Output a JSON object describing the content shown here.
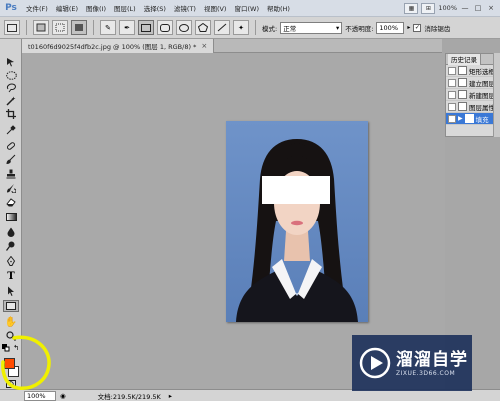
{
  "app": {
    "logo": "Ps"
  },
  "menu": [
    "文件(F)",
    "编辑(E)",
    "图像(I)",
    "图层(L)",
    "选择(S)",
    "滤镜(T)",
    "视图(V)",
    "窗口(W)",
    "帮助(H)"
  ],
  "menu_right": {
    "zoom": "100%",
    "minimize": "—",
    "restore": "□",
    "close": "×"
  },
  "options": {
    "mode_label": "模式:",
    "mode_value": "正常",
    "opacity_label": "不透明度:",
    "opacity_value": "100%",
    "antialias_label": "消除锯齿",
    "antialias_checked": true
  },
  "document": {
    "tab_title": "t0160f6d9025f4dfb2c.jpg @ 100% (图层 1, RGB/8) *"
  },
  "history": {
    "title": "历史记录",
    "items": [
      {
        "label": "矩形选框",
        "selected": false
      },
      {
        "label": "建立图层",
        "selected": false
      },
      {
        "label": "新建图层",
        "selected": false
      },
      {
        "label": "图层属性",
        "selected": false
      },
      {
        "label": "填充",
        "selected": true
      }
    ]
  },
  "colors": {
    "foreground": "#ff4b00",
    "background": "#ffffff",
    "accent": "#3a78d6",
    "annotation": "#f0f000"
  },
  "status": {
    "zoom": "100%",
    "doc_info": "文档:219.5K/219.5K"
  },
  "watermark": {
    "name": "溜溜自学",
    "url": "ZIXUE.3D66.COM"
  }
}
